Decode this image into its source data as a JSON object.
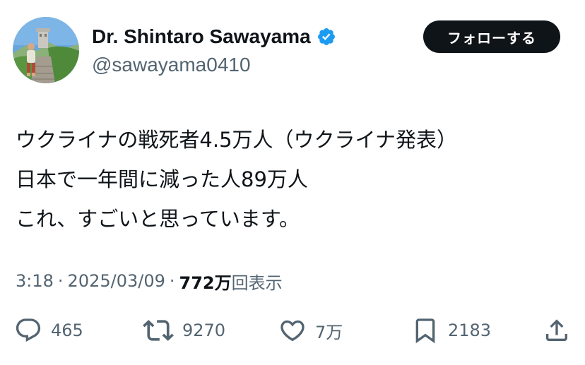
{
  "author": {
    "display_name": "Dr. Shintaro Sawayama",
    "handle": "@sawayama0410",
    "verified": true,
    "verified_color": "#1d9bf0"
  },
  "follow_button": {
    "label": "フォローする"
  },
  "tweet": {
    "lines": [
      "ウクライナの戦死者4.5万人（ウクライナ発表）",
      "日本で一年間に減った人89万人",
      "これ、すごいと思っています。"
    ],
    "time": "3:18",
    "separator": "·",
    "date": "2025/03/09",
    "views_count": "772万",
    "views_label": "回表示"
  },
  "actions": {
    "replies": {
      "icon": "reply-icon",
      "count": "465"
    },
    "reposts": {
      "icon": "repost-icon",
      "count": "9270"
    },
    "likes": {
      "icon": "heart-icon",
      "count": "7万"
    },
    "bookmarks": {
      "icon": "bookmark-icon",
      "count": "2183"
    },
    "share": {
      "icon": "share-icon"
    }
  },
  "colors": {
    "text_primary": "#0f1419",
    "text_secondary": "#536471",
    "follow_button_bg": "#0f1419",
    "follow_button_text": "#ffffff"
  }
}
